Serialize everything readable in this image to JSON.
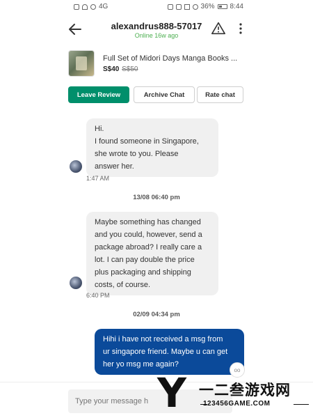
{
  "statusbar": {
    "network": "4G",
    "battery": "36%",
    "time": "8:44"
  },
  "header": {
    "username": "alexandrus888-57017",
    "online_status": "Online 16w ago"
  },
  "listing": {
    "title": "Full Set of Midori Days Manga Books ...",
    "price": "S$40",
    "old_price": "S$50"
  },
  "actions": {
    "leave_review": "Leave Review",
    "archive_chat": "Archive Chat",
    "rate_chat": "Rate chat"
  },
  "messages": [
    {
      "direction": "in",
      "lines": [
        "Hi.",
        "I found someone in Singapore,",
        "she wrote to you. Please",
        "answer her."
      ],
      "time": "1:47 AM"
    },
    {
      "separator": "13/08 06:40 pm"
    },
    {
      "direction": "in",
      "lines": [
        "Maybe something has changed",
        "and you could, however, send a",
        "package abroad? I really care a",
        "lot.  I can pay double the price",
        "plus packaging and shipping",
        "costs, of course."
      ],
      "time": "6:40 PM"
    },
    {
      "separator": "02/09 04:34 pm"
    },
    {
      "direction": "out",
      "lines": [
        "Hihi i have not received a msg from",
        "ur singapore friend. Maybe u can get",
        "her yo msg me again?"
      ],
      "badge": "oo"
    }
  ],
  "composer": {
    "placeholder": "Type your message h"
  },
  "watermark": {
    "logo_letter": "Y",
    "chinese": "一二叁游戏网",
    "url": "123456GAME.COM"
  }
}
